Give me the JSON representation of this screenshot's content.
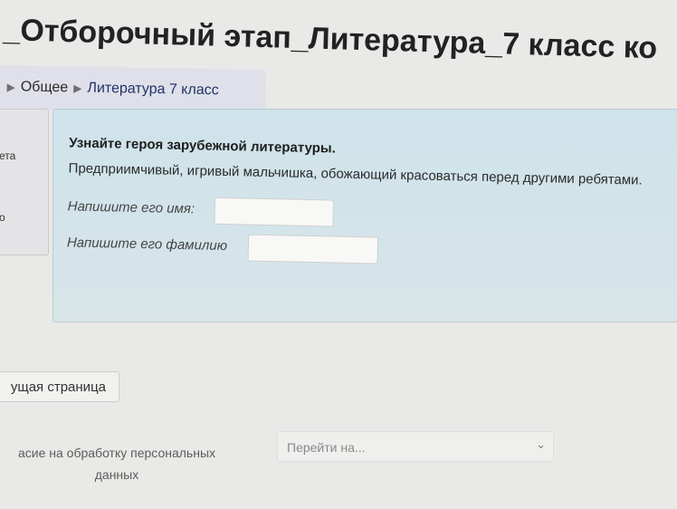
{
  "page": {
    "title": "_Отборочный этап_Литература_7 класс ко"
  },
  "breadcrumb": {
    "items": [
      {
        "label": "Общее"
      },
      {
        "label": "Литература 7 класс"
      }
    ]
  },
  "left_panel": {
    "fragment_1": "ета",
    "fragment_2": "о"
  },
  "question": {
    "title": "Узнайте героя зарубежной литературы.",
    "text": "Предприимчивый, игривый мальчишка, обожающий красоваться перед другими ребятами.",
    "fields": [
      {
        "label": "Напишите его имя:",
        "value": ""
      },
      {
        "label": "Напишите его фамилию",
        "value": ""
      }
    ]
  },
  "navigation": {
    "prev_label": "ущая страница"
  },
  "footer": {
    "consent_line1": "асие на обработку персональных",
    "consent_line2": "данных",
    "jump_placeholder": "Перейти на..."
  },
  "icons": {
    "breadcrumb_separator": "triangle-right-icon",
    "select_chevron": "chevron-down-icon"
  }
}
